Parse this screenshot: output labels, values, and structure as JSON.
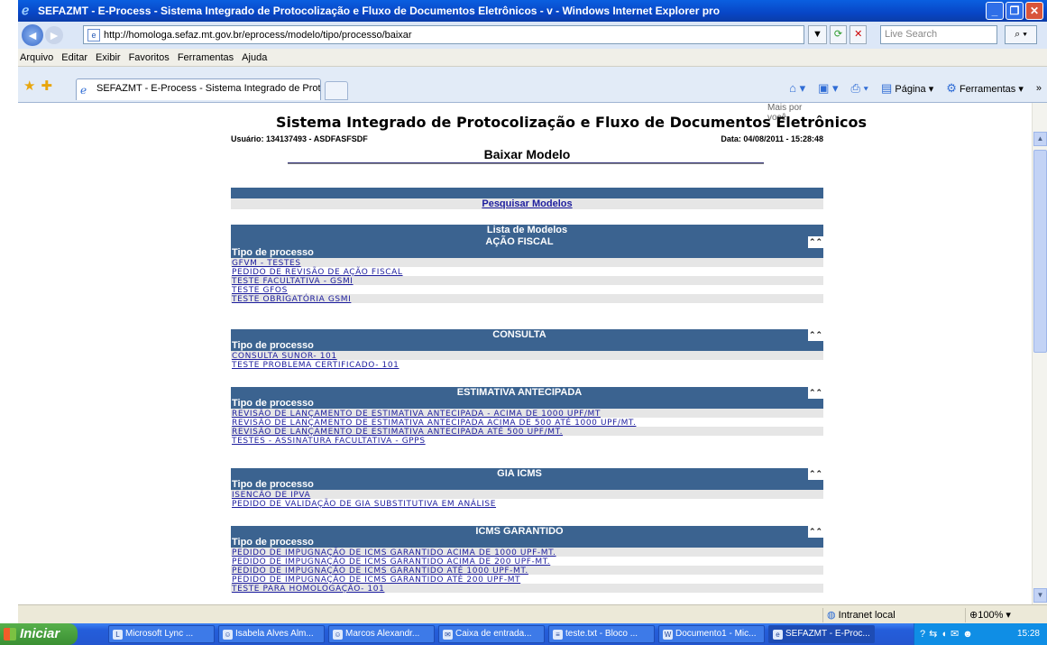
{
  "window": {
    "title": "SEFAZMT - E-Process - Sistema Integrado de Protocolização e Fluxo de Documentos Eletrônicos - v - Windows Internet Explorer pro"
  },
  "browser": {
    "url": "http://homologa.sefaz.mt.gov.br/eprocess/modelo/tipo/processo/baixar",
    "search_placeholder": "Live Search",
    "menu": [
      "Arquivo",
      "Editar",
      "Exibir",
      "Favoritos",
      "Ferramentas",
      "Ajuda"
    ],
    "tab_label": "SEFAZMT - E-Process - Sistema Integrado de Protocoli...",
    "cmd_pagina": "Página",
    "cmd_ferramentas": "Ferramentas"
  },
  "page": {
    "mais_por_voce": "Mais por você",
    "system_title": "Sistema Integrado de Protocolização e Fluxo de Documentos Eletrônicos",
    "usuario": "Usuário: 134137493 - ASDFASFSDF",
    "data": "Data: 04/08/2011 - 15:28:48",
    "heading": "Baixar Modelo",
    "search_link": "Pesquisar Modelos",
    "list_title": "Lista de Modelos",
    "tipo_label": "Tipo de processo",
    "sections": [
      {
        "name": "AÇÃO FISCAL",
        "items": [
          "GFVM - TESTES",
          "PEDIDO DE REVISÃO DE AÇÃO FISCAL",
          "TESTE FACULTATIVA - GSMI",
          "TESTE GFOS",
          "TESTE OBRIGATÓRIA GSMI"
        ]
      },
      {
        "name": "CONSULTA",
        "items": [
          "CONSULTA SUNOR- 101",
          "TESTE PROBLEMA CERTIFICADO- 101"
        ]
      },
      {
        "name": "ESTIMATIVA ANTECIPADA",
        "items": [
          "REVISÃO DE LANÇAMENTO DE ESTIMATIVA ANTECIPADA - ACIMA DE 1000 UPF/MT",
          "REVISÃO DE LANÇAMENTO DE ESTIMATIVA ANTECIPADA ACIMA DE 500 ATÉ 1000 UPF/MT.",
          "REVISÃO DE LANÇAMENTO DE ESTIMATIVA ANTECIPADA ATÉ 500 UPF/MT.",
          "TESTES - ASSINATURA FACULTATIVA - GPPS"
        ]
      },
      {
        "name": "GIA ICMS",
        "items": [
          "ISENCÃO DE IPVA",
          "PEDIDO DE VALIDAÇÃO DE GIA SUBSTITUTIVA EM ANÁLISE"
        ]
      },
      {
        "name": "ICMS GARANTIDO",
        "items": [
          "PEDIDO DE IMPUGNAÇÃO DE ICMS GARANTIDO ACIMA DE 1000 UPF-MT.",
          "PEDIDO DE IMPUGNAÇÃO DE ICMS GARANTIDO ACIMA DE 200 UPF-MT.",
          "PEDIDO DE IMPUGNAÇÃO DE ICMS GARANTIDO ATÉ 1000 UPF-MT.",
          "PEDIDO DE IMPUGNAÇÃO DE ICMS GARANTIDO ATÉ 200 UPF-MT",
          "TESTE PARA HOMOLOGAÇÃO- 101"
        ]
      }
    ]
  },
  "statusbar": {
    "zone": "Intranet local",
    "zoom": "100%"
  },
  "taskbar": {
    "start_label": "Iniciar",
    "tasks": [
      "Microsoft Lync ...",
      "Isabela Alves Alm...",
      "Marcos Alexandr...",
      "Caixa de entrada...",
      "teste.txt - Bloco ...",
      "Documento1 - Mic...",
      "SEFAZMT - E-Proc..."
    ],
    "clock": "15:28"
  }
}
